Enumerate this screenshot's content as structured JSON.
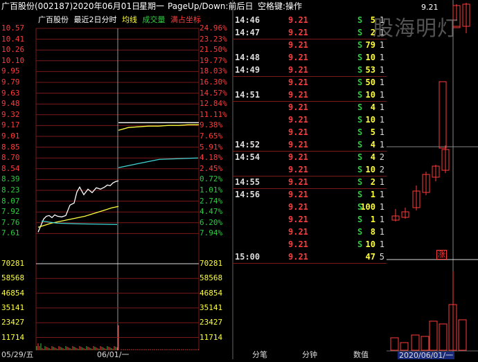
{
  "header": {
    "stock": "广百股份(002187)",
    "date": "2020年06月01日",
    "weekday": "星期一",
    "hint": "PageUp/Down:前后日",
    "hint2": "空格键:操作"
  },
  "legend": {
    "name": "广百股份",
    "mode": "最近2日分时",
    "avg": "均线",
    "vol": "成交量",
    "full": "满占坐标"
  },
  "price_ticks": [
    "10.57",
    "10.41",
    "10.26",
    "10.10",
    "9.95",
    "9.79",
    "9.63",
    "9.48",
    "9.32",
    "9.17",
    "9.01",
    "8.85",
    "8.70",
    "8.54",
    "8.39",
    "8.23",
    "8.07",
    "7.92",
    "7.76",
    "7.61"
  ],
  "pct_ticks": [
    "24.96%",
    "23.23%",
    "21.50%",
    "19.77%",
    "18.03%",
    "16.30%",
    "14.57%",
    "12.84%",
    "11.11%",
    "9.38%",
    "7.65%",
    "5.91%",
    "4.18%",
    "2.45%",
    "0.72%",
    "1.01%",
    "2.74%",
    "4.47%",
    "6.20%",
    "7.94%"
  ],
  "vol_ticks": [
    "70281",
    "58568",
    "46854",
    "35141",
    "23427",
    "11714"
  ],
  "vol_ticks_right": [
    "70281",
    "58568",
    "46854",
    "35141",
    "23427",
    "11714"
  ],
  "x_labels": {
    "day1": "05/29/五",
    "day2": "06/01/一"
  },
  "colors": {
    "up": "#ff3b3b",
    "down": "#2ecc40",
    "avg": "#ffff3d",
    "cyan": "#3fd7d7",
    "grid": "#7a1a1a",
    "white": "#ffffff"
  },
  "chart_data": {
    "type": "line",
    "series": [
      {
        "name": "day1_price",
        "x": [
          0,
          8,
          12,
          16,
          20,
          24,
          28,
          34,
          40,
          46,
          52,
          56,
          60,
          66,
          72,
          78,
          84,
          90,
          96,
          100,
          104,
          108,
          112,
          116
        ],
        "values": [
          7.63,
          7.82,
          7.86,
          7.87,
          7.84,
          7.88,
          7.86,
          7.85,
          7.87,
          8.02,
          8.05,
          8.21,
          8.28,
          8.17,
          8.25,
          8.2,
          8.27,
          8.25,
          8.28,
          8.31,
          8.3,
          8.34,
          8.36,
          8.37
        ]
      },
      {
        "name": "day1_avg",
        "values": [
          7.7,
          7.73,
          7.76,
          7.78,
          7.8,
          7.82,
          7.84,
          7.86,
          7.89,
          7.92,
          7.95,
          7.98,
          8.0
        ]
      },
      {
        "name": "day2_price",
        "values": [
          9.21,
          9.21,
          9.21,
          9.21,
          9.21,
          9.21,
          9.21,
          9.21,
          9.21
        ]
      },
      {
        "name": "day2_avg",
        "values": [
          9.1,
          9.14,
          9.15,
          9.16,
          9.16,
          9.17,
          9.17,
          9.18,
          9.18
        ]
      }
    ],
    "ylim": [
      7.61,
      10.57
    ]
  },
  "trades": [
    {
      "time": "14:46",
      "price": "9.21",
      "vol": "5",
      "bs": "S",
      "cnt": "1"
    },
    {
      "time": "14:47",
      "price": "9.21",
      "vol": "2",
      "bs": "S",
      "cnt": "1"
    },
    {
      "time": "",
      "price": "9.21",
      "vol": "79",
      "bs": "S",
      "cnt": "1"
    },
    {
      "time": "14:48",
      "price": "9.21",
      "vol": "10",
      "bs": "S",
      "cnt": "1"
    },
    {
      "time": "14:49",
      "price": "9.21",
      "vol": "53",
      "bs": "S",
      "cnt": "1"
    },
    {
      "time": "",
      "price": "9.21",
      "vol": "50",
      "bs": "S",
      "cnt": "1"
    },
    {
      "time": "14:51",
      "price": "9.21",
      "vol": "10",
      "bs": "S",
      "cnt": "1"
    },
    {
      "time": "",
      "price": "9.21",
      "vol": "4",
      "bs": "S",
      "cnt": "1"
    },
    {
      "time": "",
      "price": "9.21",
      "vol": "10",
      "bs": "S",
      "cnt": "1"
    },
    {
      "time": "",
      "price": "9.21",
      "vol": "5",
      "bs": "S",
      "cnt": "1"
    },
    {
      "time": "14:52",
      "price": "9.21",
      "vol": "4",
      "bs": "S",
      "cnt": "1"
    },
    {
      "time": "14:54",
      "price": "9.21",
      "vol": "4",
      "bs": "S",
      "cnt": "2"
    },
    {
      "time": "",
      "price": "9.21",
      "vol": "10",
      "bs": "S",
      "cnt": "2"
    },
    {
      "time": "14:55",
      "price": "9.21",
      "vol": "2",
      "bs": "S",
      "cnt": "1"
    },
    {
      "time": "14:56",
      "price": "9.21",
      "vol": "1",
      "bs": "S",
      "cnt": "1"
    },
    {
      "time": "",
      "price": "9.21",
      "vol": "100",
      "bs": "S",
      "cnt": "1"
    },
    {
      "time": "",
      "price": "9.21",
      "vol": "1",
      "bs": "S",
      "cnt": "1"
    },
    {
      "time": "",
      "price": "9.21",
      "vol": "8",
      "bs": "S",
      "cnt": "1"
    },
    {
      "time": "",
      "price": "9.21",
      "vol": "10",
      "bs": "S",
      "cnt": "1"
    },
    {
      "time": "15:00",
      "price": "9.21",
      "vol": "47",
      "bs": "",
      "cnt": "5"
    }
  ],
  "tabs": [
    "分笔",
    "分钟",
    "数值"
  ],
  "mini": {
    "price_label": "9.21",
    "zhang": "涨",
    "date_label": "2020/06/01/一",
    "watermark": "股海明灯"
  }
}
